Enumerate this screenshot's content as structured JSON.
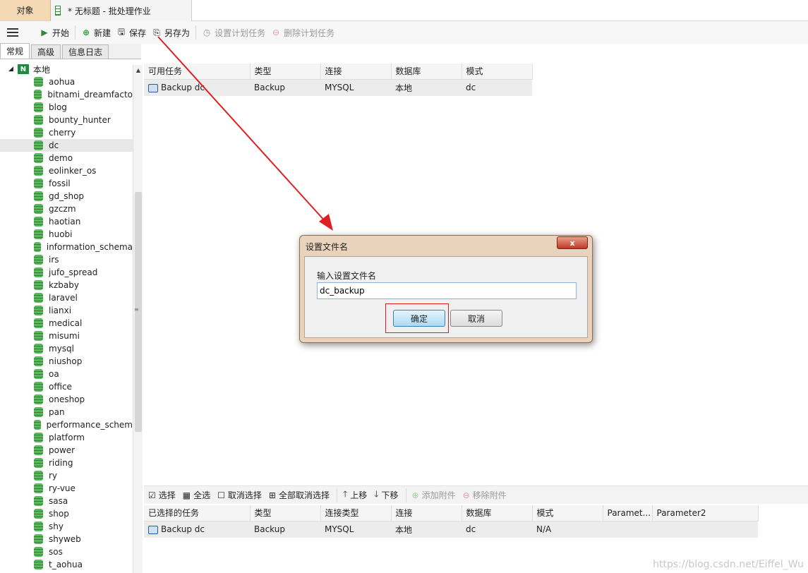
{
  "tabs": {
    "objects": "对象",
    "document": "* 无标题 - 批处理作业"
  },
  "toolbar": {
    "start": "开始",
    "new": "新建",
    "save": "保存",
    "save_as": "另存为",
    "set_schedule": "设置计划任务",
    "delete_schedule": "删除计划任务"
  },
  "left_tabs": [
    "常规",
    "高级",
    "信息日志"
  ],
  "tree": {
    "root": "本地",
    "selected": "dc",
    "items": [
      "aohua",
      "bitnami_dreamfacto",
      "blog",
      "bounty_hunter",
      "cherry",
      "dc",
      "demo",
      "eolinker_os",
      "fossil",
      "gd_shop",
      "gzczm",
      "haotian",
      "huobi",
      "information_schema",
      "irs",
      "jufo_spread",
      "kzbaby",
      "laravel",
      "lianxi",
      "medical",
      "misumi",
      "mysql",
      "niushop",
      "oa",
      "office",
      "oneshop",
      "pan",
      "performance_schem",
      "platform",
      "power",
      "riding",
      "ry",
      "ry-vue",
      "sasa",
      "shop",
      "shy",
      "shyweb",
      "sos",
      "t_aohua"
    ]
  },
  "available_tasks": {
    "headers": [
      "可用任务",
      "类型",
      "连接",
      "数据库",
      "模式"
    ],
    "rows": [
      [
        "Backup dc",
        "Backup",
        "MYSQL",
        "本地",
        "dc"
      ]
    ]
  },
  "bottom_toolbar": {
    "select": "选择",
    "select_all": "全选",
    "deselect": "取消选择",
    "deselect_all": "全部取消选择",
    "move_up": "上移",
    "move_down": "下移",
    "add_attachment": "添加附件",
    "remove_attachment": "移除附件"
  },
  "selected_tasks": {
    "headers": [
      "已选择的任务",
      "类型",
      "连接类型",
      "连接",
      "数据库",
      "模式",
      "Paramet...",
      "Parameter2"
    ],
    "rows": [
      [
        "Backup dc",
        "Backup",
        "MYSQL",
        "本地",
        "dc",
        "N/A",
        "",
        ""
      ]
    ]
  },
  "dialog": {
    "title": "设置文件名",
    "close": "x",
    "label": "输入设置文件名",
    "value": "dc_backup",
    "ok": "确定",
    "cancel": "取消"
  },
  "watermark": "https://blog.csdn.net/Eiffel_Wu",
  "colors": {
    "accent_tab": "#f5d9b5",
    "annotation_red": "#e02020",
    "db_green": "#2e7d32"
  }
}
